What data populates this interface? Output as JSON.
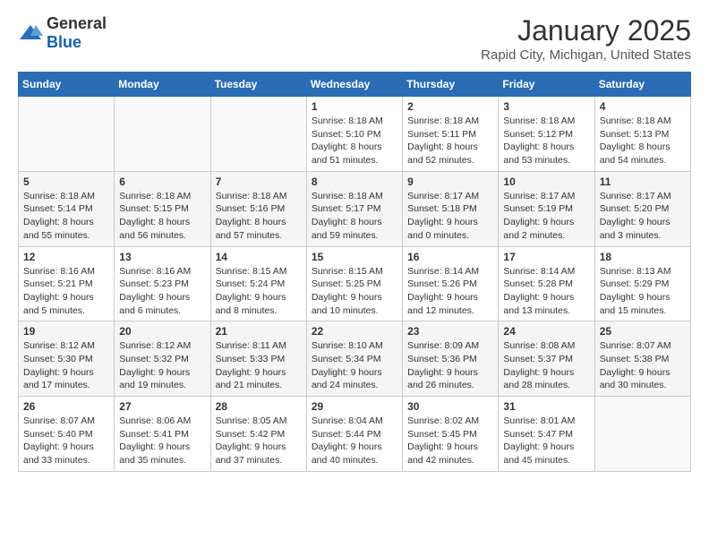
{
  "logo": {
    "general": "General",
    "blue": "Blue"
  },
  "title": "January 2025",
  "subtitle": "Rapid City, Michigan, United States",
  "days_of_week": [
    "Sunday",
    "Monday",
    "Tuesday",
    "Wednesday",
    "Thursday",
    "Friday",
    "Saturday"
  ],
  "weeks": [
    [
      {
        "day": "",
        "info": ""
      },
      {
        "day": "",
        "info": ""
      },
      {
        "day": "",
        "info": ""
      },
      {
        "day": "1",
        "info": "Sunrise: 8:18 AM\nSunset: 5:10 PM\nDaylight: 8 hours and 51 minutes."
      },
      {
        "day": "2",
        "info": "Sunrise: 8:18 AM\nSunset: 5:11 PM\nDaylight: 8 hours and 52 minutes."
      },
      {
        "day": "3",
        "info": "Sunrise: 8:18 AM\nSunset: 5:12 PM\nDaylight: 8 hours and 53 minutes."
      },
      {
        "day": "4",
        "info": "Sunrise: 8:18 AM\nSunset: 5:13 PM\nDaylight: 8 hours and 54 minutes."
      }
    ],
    [
      {
        "day": "5",
        "info": "Sunrise: 8:18 AM\nSunset: 5:14 PM\nDaylight: 8 hours and 55 minutes."
      },
      {
        "day": "6",
        "info": "Sunrise: 8:18 AM\nSunset: 5:15 PM\nDaylight: 8 hours and 56 minutes."
      },
      {
        "day": "7",
        "info": "Sunrise: 8:18 AM\nSunset: 5:16 PM\nDaylight: 8 hours and 57 minutes."
      },
      {
        "day": "8",
        "info": "Sunrise: 8:18 AM\nSunset: 5:17 PM\nDaylight: 8 hours and 59 minutes."
      },
      {
        "day": "9",
        "info": "Sunrise: 8:17 AM\nSunset: 5:18 PM\nDaylight: 9 hours and 0 minutes."
      },
      {
        "day": "10",
        "info": "Sunrise: 8:17 AM\nSunset: 5:19 PM\nDaylight: 9 hours and 2 minutes."
      },
      {
        "day": "11",
        "info": "Sunrise: 8:17 AM\nSunset: 5:20 PM\nDaylight: 9 hours and 3 minutes."
      }
    ],
    [
      {
        "day": "12",
        "info": "Sunrise: 8:16 AM\nSunset: 5:21 PM\nDaylight: 9 hours and 5 minutes."
      },
      {
        "day": "13",
        "info": "Sunrise: 8:16 AM\nSunset: 5:23 PM\nDaylight: 9 hours and 6 minutes."
      },
      {
        "day": "14",
        "info": "Sunrise: 8:15 AM\nSunset: 5:24 PM\nDaylight: 9 hours and 8 minutes."
      },
      {
        "day": "15",
        "info": "Sunrise: 8:15 AM\nSunset: 5:25 PM\nDaylight: 9 hours and 10 minutes."
      },
      {
        "day": "16",
        "info": "Sunrise: 8:14 AM\nSunset: 5:26 PM\nDaylight: 9 hours and 12 minutes."
      },
      {
        "day": "17",
        "info": "Sunrise: 8:14 AM\nSunset: 5:28 PM\nDaylight: 9 hours and 13 minutes."
      },
      {
        "day": "18",
        "info": "Sunrise: 8:13 AM\nSunset: 5:29 PM\nDaylight: 9 hours and 15 minutes."
      }
    ],
    [
      {
        "day": "19",
        "info": "Sunrise: 8:12 AM\nSunset: 5:30 PM\nDaylight: 9 hours and 17 minutes."
      },
      {
        "day": "20",
        "info": "Sunrise: 8:12 AM\nSunset: 5:32 PM\nDaylight: 9 hours and 19 minutes."
      },
      {
        "day": "21",
        "info": "Sunrise: 8:11 AM\nSunset: 5:33 PM\nDaylight: 9 hours and 21 minutes."
      },
      {
        "day": "22",
        "info": "Sunrise: 8:10 AM\nSunset: 5:34 PM\nDaylight: 9 hours and 24 minutes."
      },
      {
        "day": "23",
        "info": "Sunrise: 8:09 AM\nSunset: 5:36 PM\nDaylight: 9 hours and 26 minutes."
      },
      {
        "day": "24",
        "info": "Sunrise: 8:08 AM\nSunset: 5:37 PM\nDaylight: 9 hours and 28 minutes."
      },
      {
        "day": "25",
        "info": "Sunrise: 8:07 AM\nSunset: 5:38 PM\nDaylight: 9 hours and 30 minutes."
      }
    ],
    [
      {
        "day": "26",
        "info": "Sunrise: 8:07 AM\nSunset: 5:40 PM\nDaylight: 9 hours and 33 minutes."
      },
      {
        "day": "27",
        "info": "Sunrise: 8:06 AM\nSunset: 5:41 PM\nDaylight: 9 hours and 35 minutes."
      },
      {
        "day": "28",
        "info": "Sunrise: 8:05 AM\nSunset: 5:42 PM\nDaylight: 9 hours and 37 minutes."
      },
      {
        "day": "29",
        "info": "Sunrise: 8:04 AM\nSunset: 5:44 PM\nDaylight: 9 hours and 40 minutes."
      },
      {
        "day": "30",
        "info": "Sunrise: 8:02 AM\nSunset: 5:45 PM\nDaylight: 9 hours and 42 minutes."
      },
      {
        "day": "31",
        "info": "Sunrise: 8:01 AM\nSunset: 5:47 PM\nDaylight: 9 hours and 45 minutes."
      },
      {
        "day": "",
        "info": ""
      }
    ]
  ]
}
